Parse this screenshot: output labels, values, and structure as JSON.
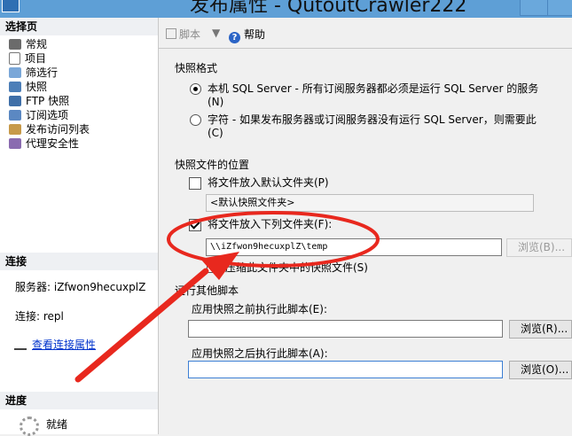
{
  "window": {
    "title": "发布属性 - QutoutCrawler222"
  },
  "left": {
    "select_page_header": "选择页",
    "pages": [
      {
        "label": "常规",
        "icon": "wrench-icon"
      },
      {
        "label": "项目",
        "icon": "document-icon"
      },
      {
        "label": "筛选行",
        "icon": "filter-icon"
      },
      {
        "label": "快照",
        "icon": "snapshot-icon"
      },
      {
        "label": "FTP 快照",
        "icon": "ftp-icon"
      },
      {
        "label": "订阅选项",
        "icon": "subscription-icon"
      },
      {
        "label": "发布访问列表",
        "icon": "users-icon"
      },
      {
        "label": "代理安全性",
        "icon": "security-icon"
      }
    ],
    "connection_header": "连接",
    "server_label": "服务器: iZfwon9hecuxplZ",
    "connection_label": "连接: repl",
    "view_connection_link": "查看连接属性",
    "progress_header": "进度",
    "progress_status": "就绪"
  },
  "toolbar": {
    "script_label": "脚本",
    "help_label": "帮助"
  },
  "snapshot_format": {
    "group_label": "快照格式",
    "native_option": "本机 SQL Server - 所有订阅服务器都必须是运行 SQL Server 的服务",
    "native_hotkey": "(N)",
    "char_option": "字符 - 如果发布服务器或订阅服务器没有运行 SQL Server，则需要此",
    "char_hotkey": "(C)",
    "selected": "native"
  },
  "snapshot_location": {
    "group_label": "快照文件的位置",
    "default_folder_label": "将文件放入默认文件夹(P)",
    "default_folder_checked": false,
    "default_folder_value": "<默认快照文件夹>",
    "custom_folder_label": "将文件放入下列文件夹(F):",
    "custom_folder_checked": true,
    "custom_folder_value": "\\\\iZfwon9hecuxplZ\\temp",
    "browse_label_1": "浏览(B)...",
    "compress_label": "压缩此文件夹中的快照文件(S)",
    "compress_checked": false
  },
  "scripts": {
    "group_label": "运行其他脚本",
    "before_label": "应用快照之前执行此脚本(E):",
    "before_value": "",
    "browse_label_2": "浏览(R)...",
    "after_label": "应用快照之后执行此脚本(A):",
    "after_value": "",
    "browse_label_3": "浏览(O)..."
  },
  "colors": {
    "annotation_red": "#e8281e",
    "link_blue": "#0033cc",
    "titlebar_blue": "#5e9fd6"
  }
}
